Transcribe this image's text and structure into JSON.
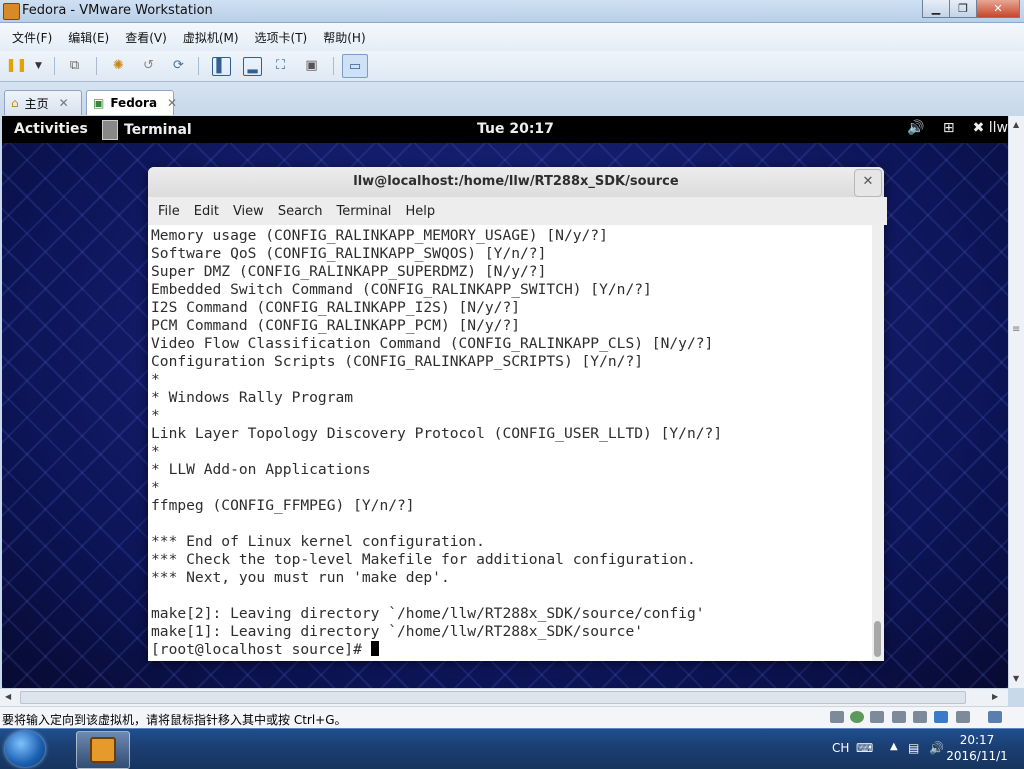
{
  "window": {
    "title": "Fedora - VMware Workstation",
    "controls": {
      "minimize": "▁",
      "restore": "❐",
      "close": "✕"
    }
  },
  "menu": [
    "文件(F)",
    "编辑(E)",
    "查看(V)",
    "虚拟机(M)",
    "选项卡(T)",
    "帮助(H)"
  ],
  "toolbar": {
    "icons": [
      "power-icon",
      "dropdown-icon",
      "network-icon",
      "snapshot-icon",
      "revert-snapshot-icon",
      "snapshot-manager-icon",
      "console-view-icon",
      "thumbnail-bar-icon",
      "fullscreen-icon",
      "unity-icon",
      "library-icon"
    ]
  },
  "tabs": [
    {
      "label": "主页",
      "active": false,
      "close": "✕"
    },
    {
      "label": "Fedora",
      "active": true,
      "close": "✕"
    }
  ],
  "gnome_panel": {
    "activities": "Activities",
    "app": "Terminal",
    "clock": "Tue 20:17",
    "user": "llw"
  },
  "terminal": {
    "title": "llw@localhost:/home/llw/RT288x_SDK/source",
    "menu": [
      "File",
      "Edit",
      "View",
      "Search",
      "Terminal",
      "Help"
    ],
    "lines": [
      "Memory usage (CONFIG_RALINKAPP_MEMORY_USAGE) [N/y/?]",
      "Software QoS (CONFIG_RALINKAPP_SWQOS) [Y/n/?]",
      "Super DMZ (CONFIG_RALINKAPP_SUPERDMZ) [N/y/?]",
      "Embedded Switch Command (CONFIG_RALINKAPP_SWITCH) [Y/n/?]",
      "I2S Command (CONFIG_RALINKAPP_I2S) [N/y/?]",
      "PCM Command (CONFIG_RALINKAPP_PCM) [N/y/?]",
      "Video Flow Classification Command (CONFIG_RALINKAPP_CLS) [N/y/?]",
      "Configuration Scripts (CONFIG_RALINKAPP_SCRIPTS) [Y/n/?]",
      "*",
      "* Windows Rally Program",
      "*",
      "Link Layer Topology Discovery Protocol (CONFIG_USER_LLTD) [Y/n/?]",
      "*",
      "* LLW Add-on Applications",
      "*",
      "ffmpeg (CONFIG_FFMPEG) [Y/n/?]",
      "",
      "*** End of Linux kernel configuration.",
      "*** Check the top-level Makefile for additional configuration.",
      "*** Next, you must run 'make dep'.",
      "",
      "make[2]: Leaving directory `/home/llw/RT288x_SDK/source/config'",
      "make[1]: Leaving directory `/home/llw/RT288x_SDK/source'"
    ],
    "prompt": "[root@localhost source]# "
  },
  "status_bar": {
    "message": "要将输入定向到该虚拟机，请将鼠标指针移入其中或按 Ctrl+G。"
  },
  "taskbar": {
    "lang": "CH",
    "time": "20:17",
    "date": "2016/11/1"
  }
}
